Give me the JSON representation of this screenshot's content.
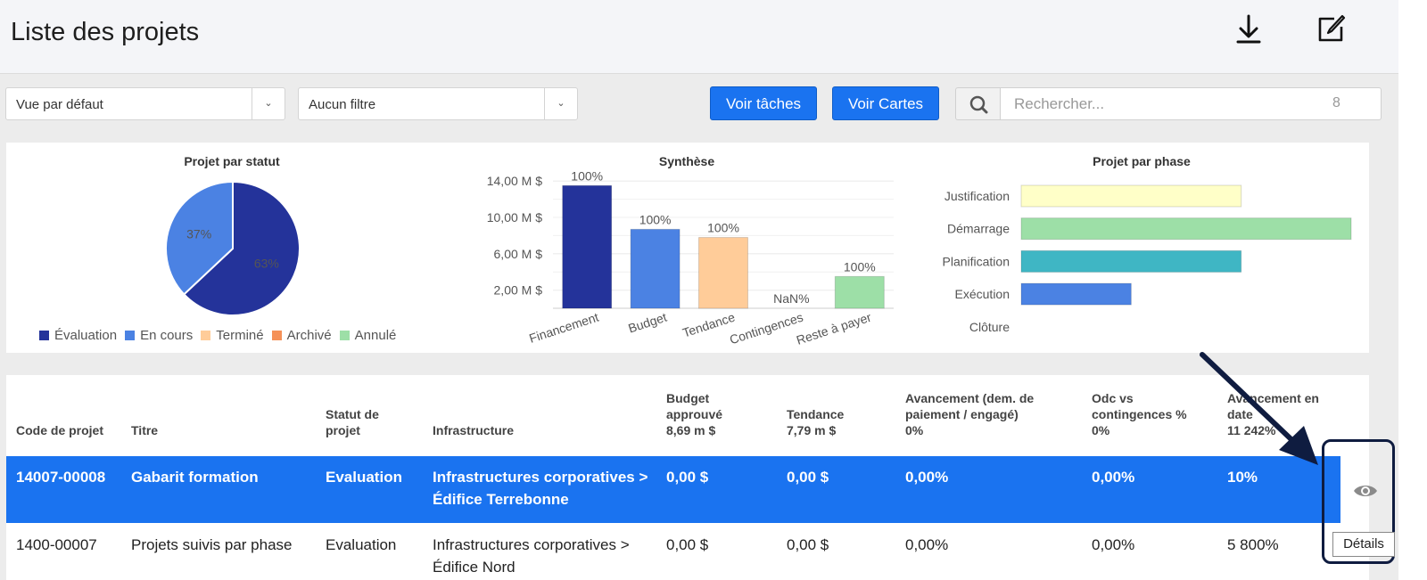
{
  "header": {
    "title": "Liste des projets",
    "icons": [
      "download-icon",
      "edit-icon"
    ]
  },
  "toolbar": {
    "view_select": "Vue par défaut",
    "filter_select": "Aucun filtre",
    "btn_tasks": "Voir tâches",
    "btn_cards": "Voir Cartes",
    "search_placeholder": "Rechercher...",
    "search_count": "8"
  },
  "charts": {
    "status": {
      "title": "Projet par statut",
      "slices": [
        {
          "label": "Évaluation",
          "value": 63,
          "text": "63%",
          "color": "#24339a"
        },
        {
          "label": "En cours",
          "value": 37,
          "text": "37%",
          "color": "#4b82e3"
        }
      ],
      "legend": [
        {
          "label": "Évaluation",
          "color": "#24339a"
        },
        {
          "label": "En cours",
          "color": "#4b82e3"
        },
        {
          "label": "Terminé",
          "color": "#ffcc99"
        },
        {
          "label": "Archivé",
          "color": "#f59158"
        },
        {
          "label": "Annulé",
          "color": "#9ddfa7"
        }
      ]
    },
    "synthese": {
      "title": "Synthèse",
      "ticks": [
        "14,00 M $",
        "10,00 M $",
        "6,00 M $",
        "2,00 M $"
      ],
      "tick_values": [
        14,
        10,
        6,
        2
      ],
      "ylim": [
        0,
        15
      ],
      "bars": [
        {
          "label": "Financement",
          "value": 13.5,
          "pct": "100%",
          "color": "#24339a"
        },
        {
          "label": "Budget",
          "value": 8.69,
          "pct": "100%",
          "color": "#4b82e3"
        },
        {
          "label": "Tendance",
          "value": 7.79,
          "pct": "100%",
          "color": "#ffcc99"
        },
        {
          "label": "Contingences",
          "value": 0,
          "pct": "NaN%",
          "color": "#f59158"
        },
        {
          "label": "Reste à payer",
          "value": 3.5,
          "pct": "100%",
          "color": "#9ddfa7"
        }
      ]
    },
    "phase": {
      "title": "Projet par phase",
      "bars": [
        {
          "label": "Justification",
          "value": 2,
          "color": "#ffffc8"
        },
        {
          "label": "Démarrage",
          "value": 3,
          "color": "#9ddfa7"
        },
        {
          "label": "Planification",
          "value": 2,
          "color": "#3fb6c4"
        },
        {
          "label": "Exécution",
          "value": 1,
          "color": "#4b82e3"
        },
        {
          "label": "Clôture",
          "value": 0,
          "color": "#bbbbbb"
        }
      ],
      "xmax": 3
    }
  },
  "table": {
    "headers": {
      "code": "Code de projet",
      "titre": "Titre",
      "statut_l1": "Statut de",
      "statut_l2": "projet",
      "infra": "Infrastructure",
      "budget_l1": "Budget",
      "budget_l2": "approuvé",
      "budget_l3": "8,69 m $",
      "tend_l1": "Tendance",
      "tend_l2": "7,79 m $",
      "av_l1": "Avancement (dem. de",
      "av_l2": "paiement / engagé)",
      "av_l3": "0%",
      "odc_l1": "Odc vs",
      "odc_l2": "contingences %",
      "odc_l3": "0%",
      "avd_l1": "Avancement en",
      "avd_l2": "date",
      "avd_l3": "11 242%"
    },
    "rows": [
      {
        "code": "14007-00008",
        "titre": "Gabarit formation",
        "statut": "Evaluation",
        "infra_l1": "Infrastructures corporatives >",
        "infra_l2": "Édifice Terrebonne",
        "budget": "0,00 $",
        "tendance": "0,00 $",
        "avancement": "0,00%",
        "odc": "0,00%",
        "av_date": "10%"
      },
      {
        "code": "1400-00007",
        "titre": "Projets suivis par phase",
        "statut": "Evaluation",
        "infra_l1": "Infrastructures corporatives >",
        "infra_l2": "Édifice Nord",
        "budget": "0,00 $",
        "tendance": "0,00 $",
        "avancement": "0,00%",
        "odc": "0,00%",
        "av_date": "5 800%"
      }
    ]
  },
  "tooltip": "Détails"
}
